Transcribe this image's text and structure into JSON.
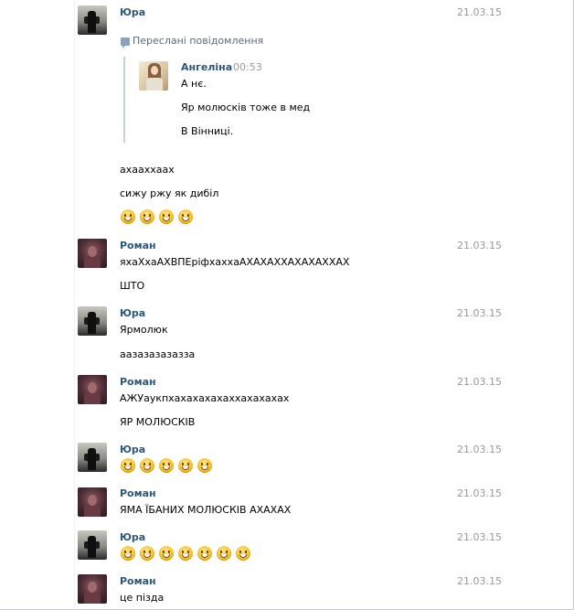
{
  "forwarded": {
    "label": "Переслані повідомлення"
  },
  "inner": {
    "name": "Ангеліна",
    "time": "00:53",
    "lines": [
      "А нє.",
      "Яр молюсків тоже в мед",
      "В Вінниці."
    ]
  },
  "messages": [
    {
      "name": "Юра",
      "date": "21.03.15"
    },
    {
      "lines": [
        "ахааххаах",
        "сижу ржу як дибіл"
      ]
    },
    {
      "name": "Роман",
      "date": "21.03.15",
      "lines": [
        "яхаХхаАХВПЕріфхаххаАХАХАХХАХАХАХХАХ",
        "ШТО"
      ]
    },
    {
      "name": "Юра",
      "date": "21.03.15",
      "lines": [
        "Ярмолюк",
        "аазазазазазза"
      ]
    },
    {
      "name": "Роман",
      "date": "21.03.15",
      "lines": [
        "АЖУаукпхахахахахаххахахахах",
        "ЯР МОЛЮСКІВ"
      ]
    },
    {
      "name": "Юра",
      "date": "21.03.15"
    },
    {
      "name": "Роман",
      "date": "21.03.15",
      "lines": [
        "ЯМА ЇБАНИХ МОЛЮСКІВ АХАХАХ"
      ]
    },
    {
      "name": "Юра",
      "date": "21.03.15"
    },
    {
      "name": "Роман",
      "date": "21.03.15",
      "lines": [
        "це пізда"
      ]
    }
  ],
  "emoji_rows": {
    "row1": 4,
    "row2": 5,
    "row3": 7
  },
  "colors": {
    "name": "#2b587a",
    "date": "#999999",
    "forward_bar": "#c6d1dc"
  }
}
